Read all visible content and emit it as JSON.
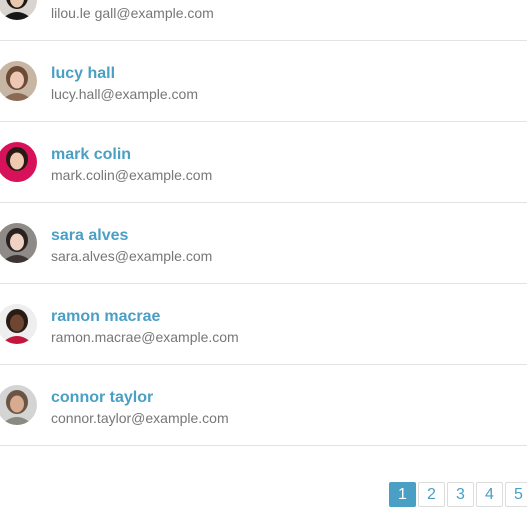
{
  "users": [
    {
      "name": "",
      "email": "lilou.le gall@example.com",
      "avatar": {
        "bg": "#d9d4cf",
        "skin": "#e9c7ae",
        "hair": "#1e1715",
        "shirt": "#171717",
        "icon": "user-avatar-icon"
      }
    },
    {
      "name": "lucy hall",
      "email": "lucy.hall@example.com",
      "avatar": {
        "bg": "#c8b6a4",
        "skin": "#edc7b3",
        "hair": "#6b4a36",
        "shirt": "#8a6a55",
        "icon": "user-avatar-icon"
      }
    },
    {
      "name": "mark colin",
      "email": "mark.colin@example.com",
      "avatar": {
        "bg": "#d8125a",
        "skin": "#f0c9b2",
        "hair": "#2a1a14",
        "shirt": "#d8125a",
        "icon": "user-avatar-icon"
      }
    },
    {
      "name": "sara alves",
      "email": "sara.alves@example.com",
      "avatar": {
        "bg": "#8d8a88",
        "skin": "#efd2c4",
        "hair": "#2b211e",
        "shirt": "#3d3534",
        "icon": "user-avatar-icon"
      }
    },
    {
      "name": "ramon macrae",
      "email": "ramon.macrae@example.com",
      "avatar": {
        "bg": "#eeeeee",
        "skin": "#6f4632",
        "hair": "#2a1c15",
        "shirt": "#c3163c",
        "icon": "user-avatar-icon"
      }
    },
    {
      "name": "connor taylor",
      "email": "connor.taylor@example.com",
      "avatar": {
        "bg": "#d4d4d4",
        "skin": "#d7ab8f",
        "hair": "#6a5444",
        "shirt": "#8a8a82",
        "icon": "user-avatar-icon"
      }
    }
  ],
  "pagination": {
    "pages": [
      "1",
      "2",
      "3",
      "4",
      "5"
    ],
    "active": "1"
  },
  "colors": {
    "accent": "#4a9fc4",
    "email_text": "#777777",
    "divider": "#e3e3e3"
  }
}
